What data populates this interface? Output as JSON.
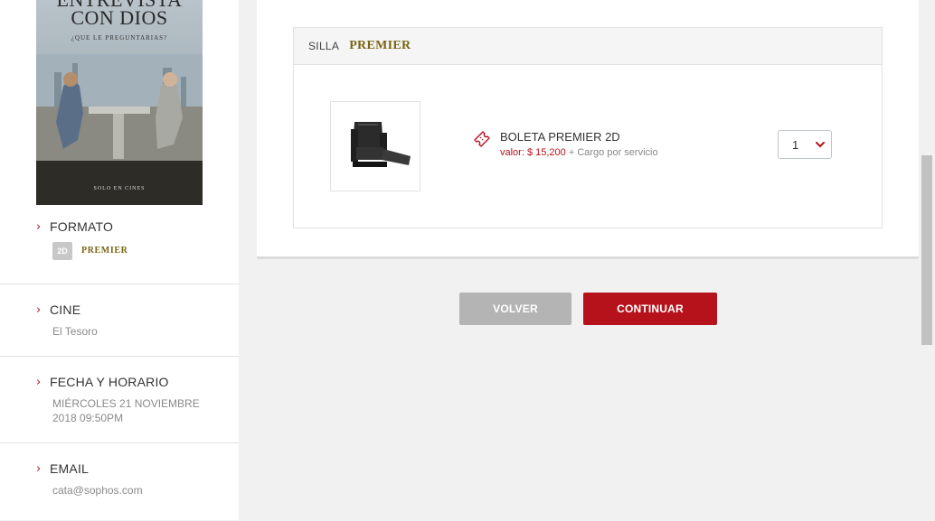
{
  "poster": {
    "title_line1": "ENTREVISTA",
    "title_line2": "CON DIOS",
    "tagline": "¿QUE LE PREGUNTARIAS?",
    "footer": "SOLO EN CINES"
  },
  "sidebar": {
    "formato": {
      "label": "FORMATO",
      "badge": "2D",
      "value": "PREMIER"
    },
    "cine": {
      "label": "CINE",
      "value": "El Tesoro"
    },
    "fecha": {
      "label": "FECHA Y HORARIO",
      "value_line1": "MIÉRCOLES 21 NOVIEMBRE",
      "value_line2": "2018 09:50PM"
    },
    "email": {
      "label": "EMAIL",
      "value": "cata@sophos.com"
    }
  },
  "seat_box": {
    "heading_prefix": "SILLA",
    "heading_type": "PREMIER",
    "ticket_name": "BOLETA PREMIER 2D",
    "price_label": "valor: $ 15,200",
    "price_suffix": " + Cargo por servicio",
    "quantity": "1",
    "thumbnail_icon": "recliner-seat-image",
    "ticket_icon": "ticket-icon"
  },
  "actions": {
    "back_label": "VOLVER",
    "continue_label": "CONTINUAR"
  },
  "colors": {
    "accent": "#b5121b",
    "gold": "#7a6514",
    "disabled": "#b4b4b4"
  }
}
